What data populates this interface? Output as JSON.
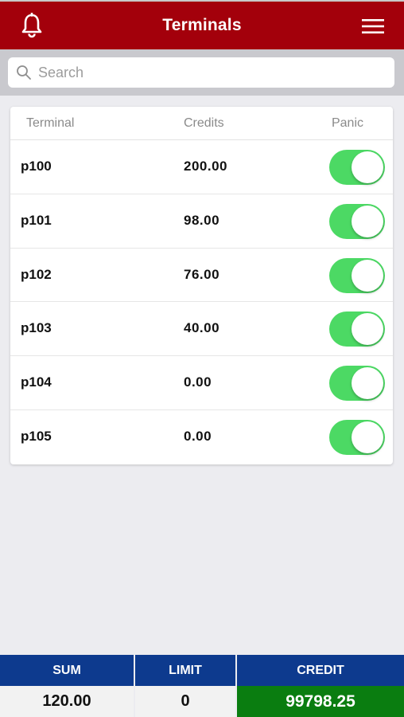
{
  "header": {
    "title": "Terminals"
  },
  "search": {
    "placeholder": "Search"
  },
  "table": {
    "columns": [
      "Terminal",
      "Credits",
      "Panic"
    ],
    "rows": [
      {
        "terminal": "p100",
        "credits": "200.00",
        "panic": true
      },
      {
        "terminal": "p101",
        "credits": "98.00",
        "panic": true
      },
      {
        "terminal": "p102",
        "credits": "76.00",
        "panic": true
      },
      {
        "terminal": "p103",
        "credits": "40.00",
        "panic": true
      },
      {
        "terminal": "p104",
        "credits": "0.00",
        "panic": true
      },
      {
        "terminal": "p105",
        "credits": "0.00",
        "panic": true
      }
    ]
  },
  "footer": {
    "sum_label": "SUM",
    "sum_value": "120.00",
    "limit_label": "LIMIT",
    "limit_value": "0",
    "credit_label": "CREDIT",
    "credit_value": "99798.25"
  },
  "icons": {
    "bell": "bell-icon",
    "menu": "hamburger-menu-icon",
    "search": "search-icon"
  },
  "colors": {
    "header_bg": "#a3000b",
    "toggle_on": "#4cd964",
    "footer_head_bg": "#0d3a8e",
    "credit_bg": "#0a7d10"
  }
}
